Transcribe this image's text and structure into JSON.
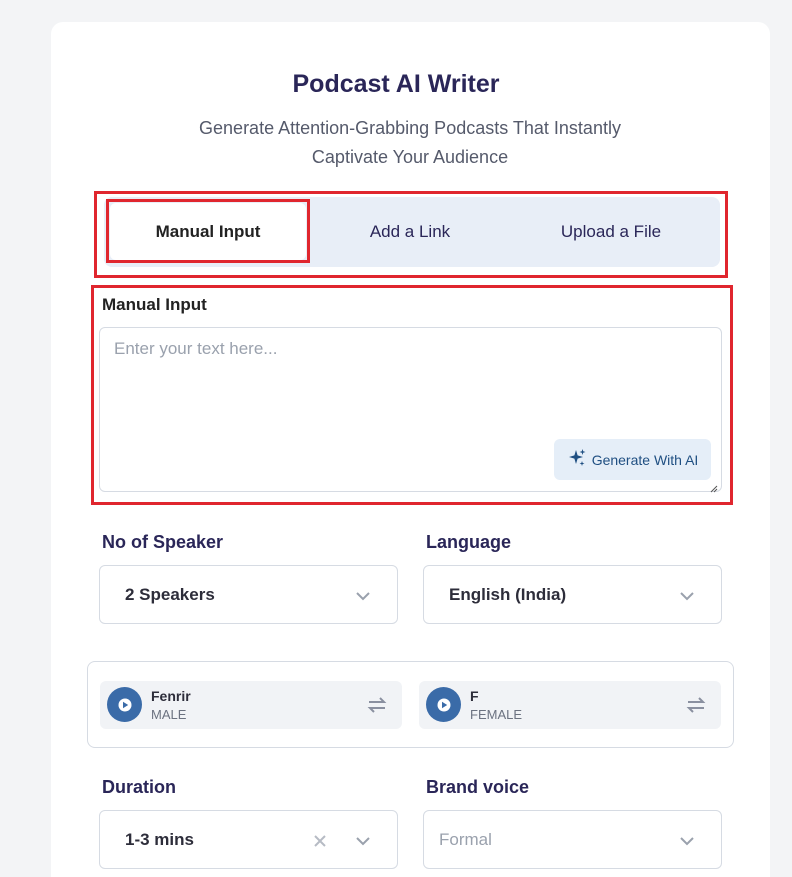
{
  "header": {
    "title": "Podcast AI Writer",
    "subtitle": "Generate Attention-Grabbing Podcasts That Instantly Captivate Your Audience"
  },
  "tabs": [
    {
      "label": "Manual Input",
      "active": true
    },
    {
      "label": "Add a Link",
      "active": false
    },
    {
      "label": "Upload a File",
      "active": false
    }
  ],
  "manual_input": {
    "label": "Manual Input",
    "placeholder": "Enter your text here...",
    "generate_label": "Generate With AI"
  },
  "speaker_count": {
    "label": "No of Speaker",
    "value": "2 Speakers"
  },
  "language": {
    "label": "Language",
    "value": "English (India)"
  },
  "voices": [
    {
      "name": "Fenrir",
      "gender": "MALE"
    },
    {
      "name": "F",
      "gender": "FEMALE"
    }
  ],
  "duration": {
    "label": "Duration",
    "value": "1-3 mins"
  },
  "brand_voice": {
    "label": "Brand voice",
    "placeholder": "Formal"
  },
  "colors": {
    "accent": "#3a6ba8",
    "highlight": "#e0262e",
    "title": "#2a2658"
  },
  "icons": [
    "sparkle-icon",
    "chevron-down-icon",
    "play-icon",
    "swap-icon",
    "clear-icon",
    "resize-handle-icon"
  ]
}
